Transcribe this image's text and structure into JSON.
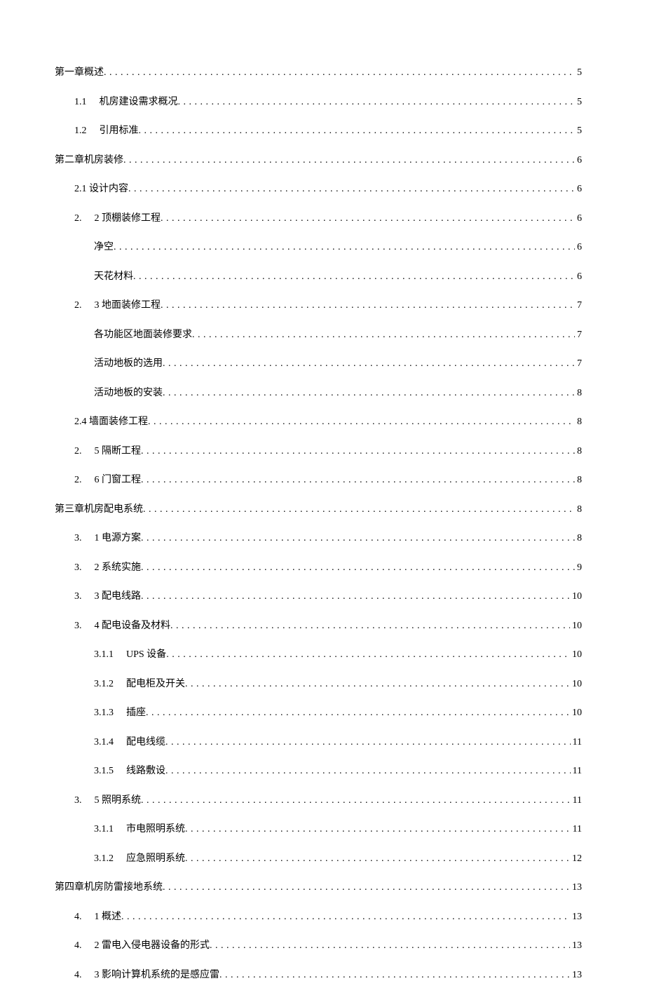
{
  "toc": [
    {
      "indent": 0,
      "prefix": "",
      "title": "第一章概述",
      "page": "5",
      "prefixClass": "cn",
      "gap": ""
    },
    {
      "indent": 1,
      "prefix": "1.1",
      "title": "机房建设需求概况",
      "page": "5",
      "prefixClass": "num-prefix",
      "gap": "wide"
    },
    {
      "indent": 1,
      "prefix": "1.2",
      "title": "引用标准",
      "page": "5",
      "prefixClass": "num-prefix",
      "gap": "wide"
    },
    {
      "indent": 0,
      "prefix": "",
      "title": "第二章机房装修",
      "page": "6",
      "prefixClass": "cn",
      "gap": ""
    },
    {
      "indent": 1,
      "prefix": "",
      "title": "2.1 设计内容",
      "page": "6",
      "prefixClass": "cn",
      "gap": ""
    },
    {
      "indent": 1,
      "prefix": "2.",
      "title": "2 顶棚装修工程",
      "page": "6",
      "prefixClass": "num-prefix",
      "gap": "wide"
    },
    {
      "indent": 2,
      "prefix": "",
      "title": "净空",
      "page": "6",
      "prefixClass": "cn",
      "gap": ""
    },
    {
      "indent": 2,
      "prefix": "",
      "title": "天花材料",
      "page": "6",
      "prefixClass": "cn",
      "gap": ""
    },
    {
      "indent": 1,
      "prefix": "2.",
      "title": "3 地面装修工程",
      "page": "7",
      "prefixClass": "num-prefix",
      "gap": "wide"
    },
    {
      "indent": 2,
      "prefix": "",
      "title": "各功能区地面装修要求",
      "page": "7",
      "prefixClass": "cn",
      "gap": ""
    },
    {
      "indent": 2,
      "prefix": "",
      "title": "活动地板的选用",
      "page": "7",
      "prefixClass": "cn",
      "gap": ""
    },
    {
      "indent": 2,
      "prefix": "",
      "title": "活动地板的安装",
      "page": "8",
      "prefixClass": "cn",
      "gap": ""
    },
    {
      "indent": 1,
      "prefix": "",
      "title": "2.4 墙面装修工程",
      "page": "8",
      "prefixClass": "cn",
      "gap": ""
    },
    {
      "indent": 1,
      "prefix": "2.",
      "title": "5 隔断工程",
      "page": "8",
      "prefixClass": "num-prefix",
      "gap": "wide"
    },
    {
      "indent": 1,
      "prefix": "2.",
      "title": "6 门窗工程",
      "page": "8",
      "prefixClass": "num-prefix",
      "gap": "wide"
    },
    {
      "indent": 0,
      "prefix": "",
      "title": "第三章机房配电系统",
      "page": "8",
      "prefixClass": "cn",
      "gap": ""
    },
    {
      "indent": 1,
      "prefix": "3.",
      "title": "1 电源方案",
      "page": "8",
      "prefixClass": "num-prefix",
      "gap": "wide"
    },
    {
      "indent": 1,
      "prefix": "3.",
      "title": "2 系统实施",
      "page": "9",
      "prefixClass": "num-prefix",
      "gap": "wide"
    },
    {
      "indent": 1,
      "prefix": "3.",
      "title": "3 配电线路",
      "page": "10",
      "prefixClass": "num-prefix",
      "gap": "wide"
    },
    {
      "indent": 1,
      "prefix": "3.",
      "title": "4 配电设备及材料",
      "page": "10",
      "prefixClass": "num-prefix",
      "gap": "wide"
    },
    {
      "indent": 2,
      "prefix": "3.1.1",
      "title": "UPS 设备",
      "page": "10",
      "prefixClass": "num-prefix",
      "gap": "wide"
    },
    {
      "indent": 2,
      "prefix": "3.1.2",
      "title": "配电柜及开关",
      "page": "10",
      "prefixClass": "num-prefix",
      "gap": "wide"
    },
    {
      "indent": 2,
      "prefix": "3.1.3",
      "title": "插座",
      "page": "10",
      "prefixClass": "num-prefix",
      "gap": "wide"
    },
    {
      "indent": 2,
      "prefix": "3.1.4",
      "title": "配电线缆",
      "page": "11",
      "prefixClass": "num-prefix",
      "gap": "wide"
    },
    {
      "indent": 2,
      "prefix": "3.1.5",
      "title": "线路敷设",
      "page": "11",
      "prefixClass": "num-prefix",
      "gap": "wide"
    },
    {
      "indent": 1,
      "prefix": "3.",
      "title": "5 照明系统",
      "page": "11",
      "prefixClass": "num-prefix",
      "gap": "wide"
    },
    {
      "indent": 2,
      "prefix": "3.1.1",
      "title": "市电照明系统",
      "page": "11",
      "prefixClass": "num-prefix",
      "gap": "wide"
    },
    {
      "indent": 2,
      "prefix": "3.1.2",
      "title": "应急照明系统",
      "page": "12",
      "prefixClass": "num-prefix",
      "gap": "wide"
    },
    {
      "indent": 0,
      "prefix": "",
      "title": "第四章机房防雷接地系统",
      "page": "13",
      "prefixClass": "cn",
      "gap": ""
    },
    {
      "indent": 1,
      "prefix": "4.",
      "title": "1 概述",
      "page": "13",
      "prefixClass": "num-prefix",
      "gap": "wide"
    },
    {
      "indent": 1,
      "prefix": "4.",
      "title": "2 雷电入侵电器设备的形式",
      "page": "13",
      "prefixClass": "num-prefix",
      "gap": "wide"
    },
    {
      "indent": 1,
      "prefix": "4.",
      "title": "3 影响计算机系统的是感应雷",
      "page": "13",
      "prefixClass": "num-prefix",
      "gap": "wide"
    }
  ]
}
